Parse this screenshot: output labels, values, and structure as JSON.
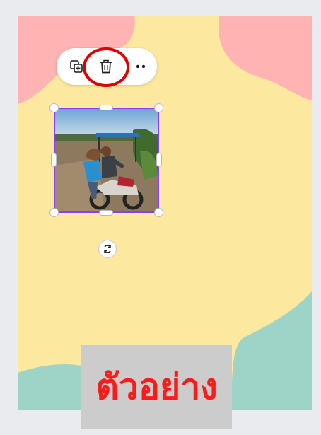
{
  "canvas": {
    "background": "#fde8a0",
    "blob_colors": {
      "pink": "#ffb3b3",
      "teal": "#9ed4c7"
    }
  },
  "toolbar": {
    "icons": {
      "duplicate": "duplicate-icon",
      "delete": "trash-icon",
      "more": "more-horizontal-icon"
    },
    "highlight_color": "#e00000"
  },
  "selection": {
    "outline_color": "#8b3dff",
    "image_subject": "motorbike-with-riders-photo",
    "rotate_icon": "rotate-icon"
  },
  "watermark": {
    "text": "ตัวอย่าง",
    "color": "#ff1a1a"
  }
}
